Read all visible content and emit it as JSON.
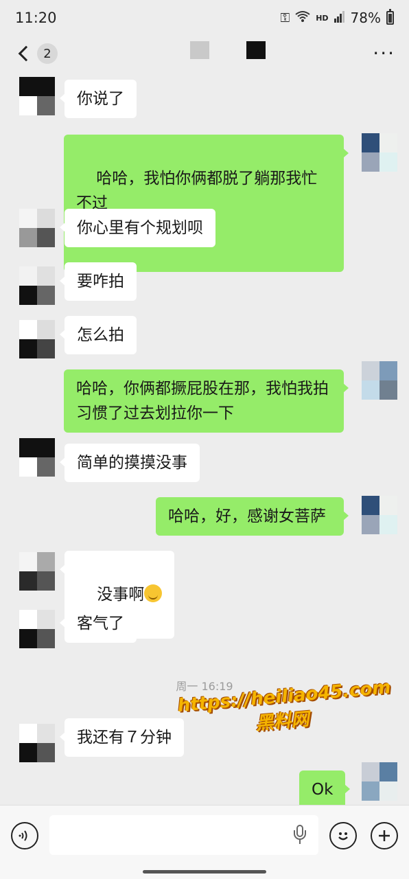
{
  "status_bar": {
    "time": "11:20",
    "network": "HD",
    "battery": "78%"
  },
  "header": {
    "unread_count": "2",
    "more_label": "···"
  },
  "messages": [
    {
      "side": "in",
      "text": "你说了"
    },
    {
      "side": "out",
      "text": "哈哈，我怕你俩都脱了躺那我忙不过\n来",
      "emoji": "zipper-face"
    },
    {
      "side": "in",
      "text": "你心里有个规划呗"
    },
    {
      "side": "in",
      "text": "要咋拍"
    },
    {
      "side": "in",
      "text": "怎么拍"
    },
    {
      "side": "out",
      "text": "哈哈，你俩都撅屁股在那，我怕我拍\n习惯了过去划拉你一下"
    },
    {
      "side": "in",
      "text": "简单的摸摸没事"
    },
    {
      "side": "out",
      "text": "哈哈，好，感谢女菩萨"
    },
    {
      "side": "in",
      "text": "没事啊",
      "emoji": "tears-of-joy"
    },
    {
      "side": "in",
      "text": "客气了"
    },
    {
      "side": "in",
      "text": "我还有７分钟"
    },
    {
      "side": "out",
      "text": "Ok"
    }
  ],
  "timestamp": "周一 16:19",
  "watermark": {
    "line1": "https://heiliao45.com",
    "line2": "黑料网"
  },
  "colors": {
    "background": "#ededed",
    "bubble_out": "#95ec69",
    "bubble_in": "#ffffff"
  },
  "input_bar": {
    "voice_icon": "voice-icon",
    "mic_icon": "microphone-icon",
    "emoji_icon": "smiley-icon",
    "plus_icon": "plus-icon"
  }
}
